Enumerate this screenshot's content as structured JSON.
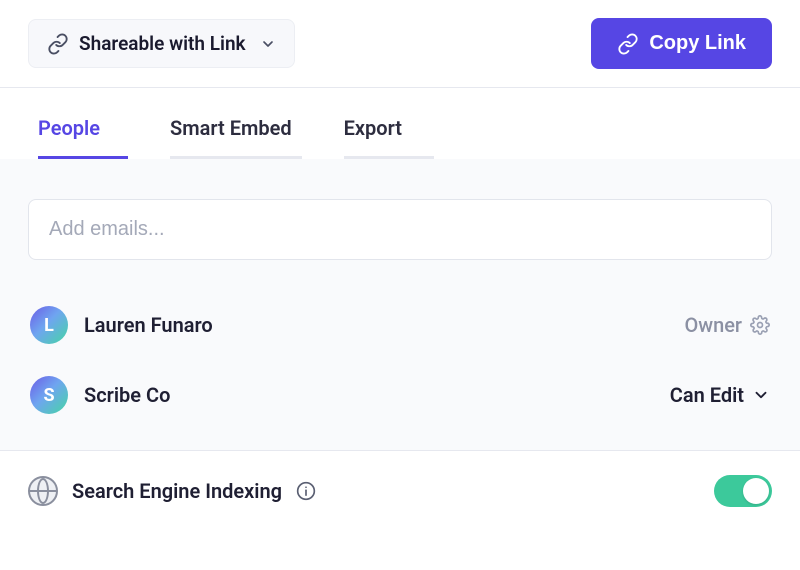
{
  "header": {
    "share_mode_label": "Shareable with Link",
    "copy_link_label": "Copy Link"
  },
  "tabs": [
    {
      "label": "People",
      "active": true
    },
    {
      "label": "Smart Embed",
      "active": false
    },
    {
      "label": "Export",
      "active": false
    }
  ],
  "email_input": {
    "placeholder": "Add emails...",
    "value": ""
  },
  "people": [
    {
      "initial": "L",
      "name": "Lauren Funaro",
      "role": "Owner",
      "role_type": "owner"
    },
    {
      "initial": "S",
      "name": "Scribe Co",
      "role": "Can Edit",
      "role_type": "select"
    }
  ],
  "footer": {
    "seo_label": "Search Engine Indexing",
    "seo_enabled": true
  },
  "colors": {
    "accent": "#5646e4",
    "toggle_on": "#3cc99b"
  }
}
